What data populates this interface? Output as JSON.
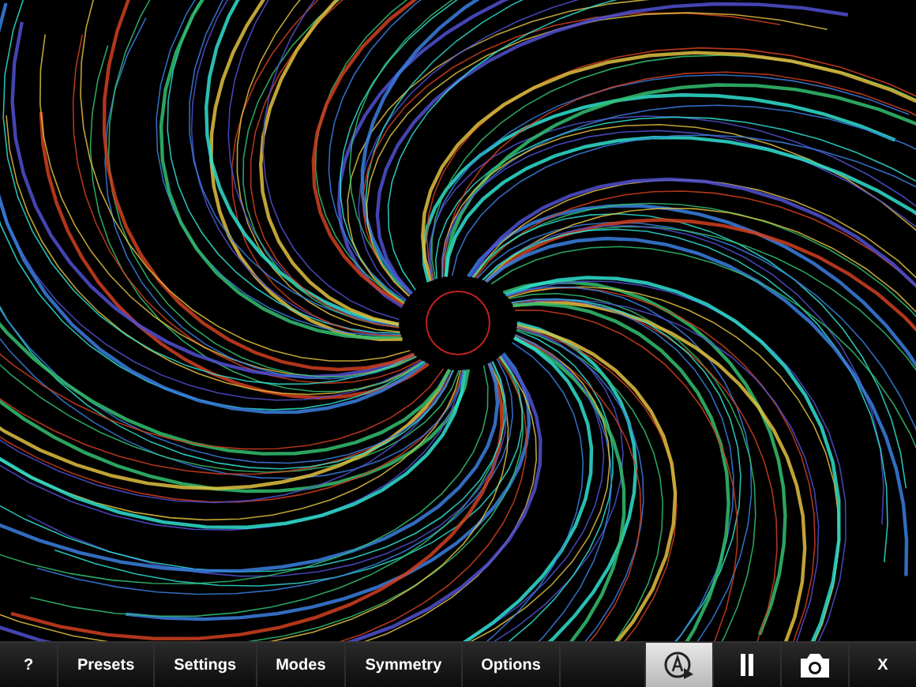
{
  "toolbar": {
    "menu_items": [
      {
        "label": "?"
      },
      {
        "label": "Presets"
      },
      {
        "label": "Settings"
      },
      {
        "label": "Modes"
      },
      {
        "label": "Symmetry"
      },
      {
        "label": "Options"
      }
    ],
    "tools": [
      {
        "kind": "autoplay",
        "selected": true
      },
      {
        "kind": "pause",
        "selected": false
      },
      {
        "kind": "camera",
        "selected": false
      },
      {
        "kind": "text",
        "label": "X",
        "selected": false
      }
    ]
  }
}
